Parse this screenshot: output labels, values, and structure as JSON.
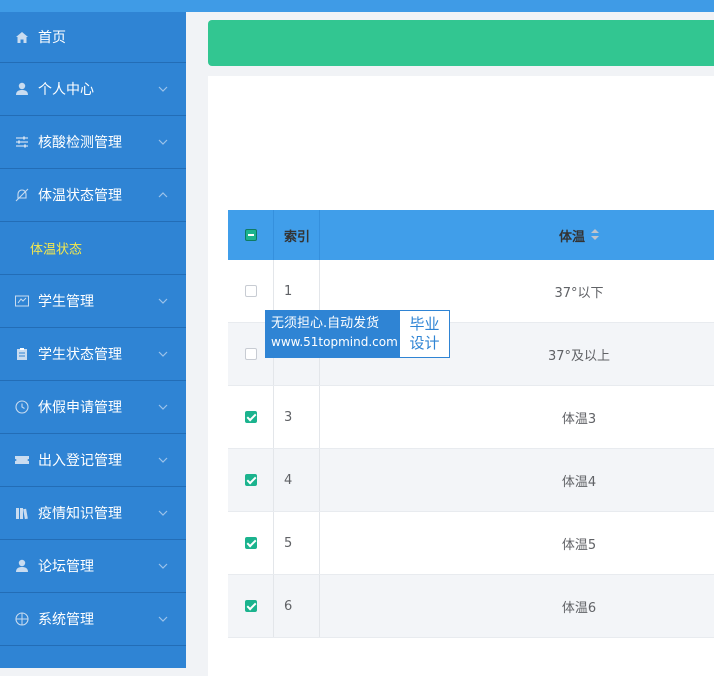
{
  "sidebar": {
    "items": [
      {
        "label": "首页",
        "icon": "home-icon",
        "expandable": false
      },
      {
        "label": "个人中心",
        "icon": "user-icon",
        "expandable": true
      },
      {
        "label": "核酸检测管理",
        "icon": "sliders-icon",
        "expandable": true
      },
      {
        "label": "体温状态管理",
        "icon": "bell-off-icon",
        "expandable": true,
        "expanded": true
      },
      {
        "label": "学生管理",
        "icon": "id-card-icon",
        "expandable": true
      },
      {
        "label": "学生状态管理",
        "icon": "clipboard-icon",
        "expandable": true
      },
      {
        "label": "休假申请管理",
        "icon": "clock-icon",
        "expandable": true
      },
      {
        "label": "出入登记管理",
        "icon": "ticket-icon",
        "expandable": true
      },
      {
        "label": "疫情知识管理",
        "icon": "book-icon",
        "expandable": true
      },
      {
        "label": "论坛管理",
        "icon": "user-icon",
        "expandable": true
      },
      {
        "label": "系统管理",
        "icon": "globe-icon",
        "expandable": true
      }
    ],
    "subitem": {
      "label": "体温状态",
      "color": "#f5e84c"
    }
  },
  "table": {
    "headers": {
      "index": "索引",
      "temperature": "体温"
    },
    "rows": [
      {
        "index": "1",
        "value": "37°以下",
        "checked": false
      },
      {
        "index": "2",
        "value": "37°及以上",
        "checked": false
      },
      {
        "index": "3",
        "value": "体温3",
        "checked": true
      },
      {
        "index": "4",
        "value": "体温4",
        "checked": true
      },
      {
        "index": "5",
        "value": "体温5",
        "checked": true
      },
      {
        "index": "6",
        "value": "体温6",
        "checked": true
      }
    ]
  },
  "watermark": {
    "line1": "无须担心.自动发货",
    "line2": "www.51topmind.com",
    "badge_line1": "毕业",
    "badge_line2": "设计"
  },
  "colors": {
    "sidebar": "#2f84d4",
    "header_bar": "#32c691",
    "table_header": "#409eea",
    "check": "#1bb38e"
  }
}
